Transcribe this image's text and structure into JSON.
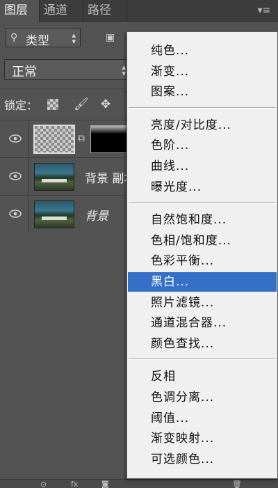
{
  "tabs": [
    {
      "label": "图层",
      "active": true
    },
    {
      "label": "通道",
      "active": false
    },
    {
      "label": "路径",
      "active": false
    }
  ],
  "panel_menu_icon": "panel-menu-icon",
  "filter": {
    "search_icon": "search-icon",
    "kind_label": "类型"
  },
  "filter_icons": [
    "image-filter-icon",
    "adjustment-filter-icon",
    "type-filter-icon",
    "shape-filter-icon",
    "smart-object-filter-icon"
  ],
  "blend_mode": "正常",
  "lock": {
    "label": "锁定：",
    "icons": [
      "lock-transparent-pixels-icon",
      "lock-image-pixels-icon",
      "lock-position-icon"
    ]
  },
  "layers": [
    {
      "name": "",
      "type": "adjustment",
      "selected": true
    },
    {
      "name": "背景 副本",
      "type": "image"
    },
    {
      "name": "背景",
      "type": "image",
      "italic": true
    }
  ],
  "menu": {
    "groups": [
      [
        "纯色...",
        "渐变...",
        "图案..."
      ],
      [
        "亮度/对比度...",
        "色阶...",
        "曲线...",
        "曝光度..."
      ],
      [
        "自然饱和度...",
        "色相/饱和度...",
        "色彩平衡...",
        "黑白...",
        "照片滤镜...",
        "通道混合器...",
        "颜色查找..."
      ],
      [
        "反相",
        "色调分离...",
        "阈值...",
        "渐变映射...",
        "可选颜色..."
      ]
    ],
    "highlighted": "黑白...",
    "highlight_color": "#3370c6"
  },
  "bottom_icons": [
    "link-layers-icon",
    "fx-icon",
    "add-mask-icon",
    "new-adjustment-layer-icon",
    "new-group-icon",
    "new-layer-icon",
    "delete-layer-icon"
  ],
  "colors": {
    "panel_bg": "#535353",
    "menu_bg": "#f0f0f0",
    "accent": "#3370c6"
  }
}
